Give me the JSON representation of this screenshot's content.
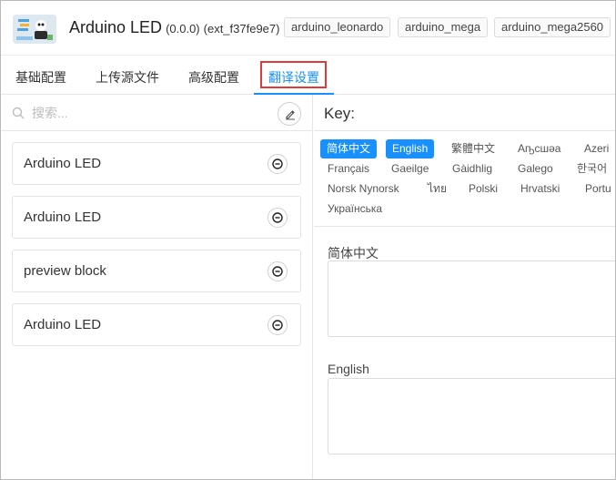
{
  "header": {
    "title": "Arduino LED",
    "version": "(0.0.0)",
    "ext_id": "(ext_f37fe9e7)",
    "tags": [
      "arduino_leonardo",
      "arduino_mega",
      "arduino_mega2560"
    ]
  },
  "tabs": [
    {
      "label": "基础配置",
      "active": false
    },
    {
      "label": "上传源文件",
      "active": false
    },
    {
      "label": "高级配置",
      "active": false
    },
    {
      "label": "翻译设置",
      "active": true
    }
  ],
  "left": {
    "search_placeholder": "搜索...",
    "items": [
      {
        "label": "Arduino LED"
      },
      {
        "label": "Arduino LED"
      },
      {
        "label": "preview block"
      },
      {
        "label": "Arduino LED"
      }
    ]
  },
  "right": {
    "key_label": "Key:",
    "languages": [
      {
        "label": "简体中文",
        "selected": true
      },
      {
        "label": "English",
        "selected": true
      },
      {
        "label": "繁體中文",
        "selected": false
      },
      {
        "label": "Аҧсшәа",
        "selected": false
      },
      {
        "label": "Azeri",
        "selected": false
      },
      {
        "label": "Français",
        "selected": false
      },
      {
        "label": "Gaeilge",
        "selected": false
      },
      {
        "label": "Gàidhlig",
        "selected": false
      },
      {
        "label": "Galego",
        "selected": false
      },
      {
        "label": "한국어",
        "selected": false
      },
      {
        "label": "Norsk Nynorsk",
        "selected": false
      },
      {
        "label": "ไทย",
        "selected": false
      },
      {
        "label": "Polski",
        "selected": false
      },
      {
        "label": "Hrvatski",
        "selected": false
      },
      {
        "label": "Portu",
        "selected": false
      },
      {
        "label": "Українська",
        "selected": false
      }
    ],
    "fields": [
      {
        "label": "简体中文",
        "value": ""
      },
      {
        "label": "English",
        "value": ""
      }
    ]
  },
  "colors": {
    "accent": "#1890ff",
    "highlight_border": "#e03a3a"
  }
}
